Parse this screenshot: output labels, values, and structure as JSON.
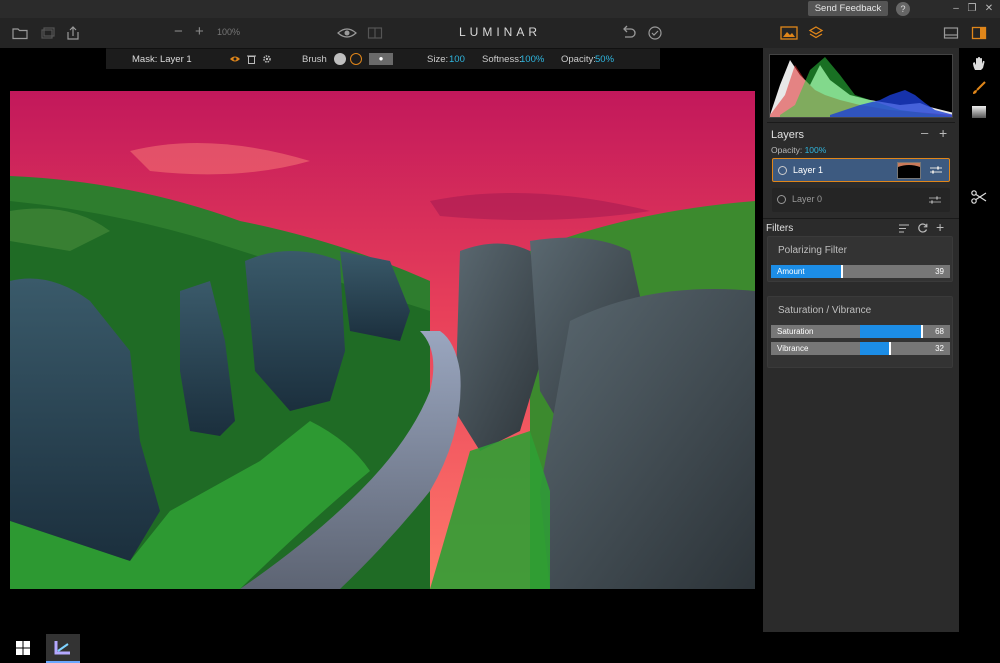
{
  "titlebar": {
    "feedback_label": "Send Feedback",
    "help_label": "?"
  },
  "toolbar": {
    "zoom_minus": "−",
    "zoom_plus": "+",
    "zoom_value": "100%",
    "logo": "LUMINAR"
  },
  "maskbar": {
    "mask_label": "Mask: Layer 1",
    "brush_label": "Brush",
    "size_label": "Size:",
    "size_value": "100",
    "softness_label": "Softness:",
    "softness_value": "100%",
    "opacity_label": "Opacity:",
    "opacity_value": "50%"
  },
  "layers": {
    "title": "Layers",
    "opacity_label": "Opacity:",
    "opacity_value": "100%",
    "items": [
      {
        "name": "Layer 1"
      },
      {
        "name": "Layer 0"
      }
    ]
  },
  "filters": {
    "title": "Filters",
    "cards": [
      {
        "title": "Polarizing Filter",
        "sliders": [
          {
            "label": "Amount",
            "value": "39",
            "level": 0.39
          }
        ]
      },
      {
        "title": "Saturation / Vibrance",
        "sliders": [
          {
            "label": "Saturation",
            "value": "68",
            "level": 0.68,
            "bipolar": true
          },
          {
            "label": "Vibrance",
            "value": "32",
            "level": 0.32,
            "bipolar": true
          }
        ]
      }
    ]
  },
  "colors": {
    "accent_orange": "#e0861a",
    "accent_cyan": "#2fb7e0",
    "slider_blue": "#1c8de6"
  }
}
